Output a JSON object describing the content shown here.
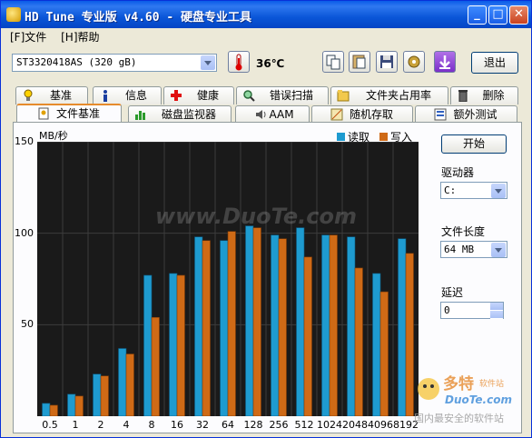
{
  "window": {
    "title": "HD Tune 专业版 v4.60 - 硬盘专业工具"
  },
  "menu": {
    "file": "[F]文件",
    "help": "[H]帮助"
  },
  "toolbar": {
    "drive": "ST3320418AS (320 gB)",
    "temperature": "36℃",
    "exit_label": "退出"
  },
  "tabs_top": [
    "基准",
    "信息",
    "健康",
    "错误扫描",
    "文件夹占用率",
    "删除"
  ],
  "tabs_bottom": [
    "文件基准",
    "磁盘监视器",
    "AAM",
    "随机存取",
    "额外测试"
  ],
  "active_tab": "文件基准",
  "right_panel": {
    "start_label": "开始",
    "drive_label": "驱动器",
    "drive_value": "C:",
    "length_label": "文件长度",
    "length_value": "64 MB",
    "delay_label": "延迟",
    "delay_value": "0"
  },
  "watermark": "www.DuoTe.com",
  "brand": {
    "name": "多特",
    "sub": "软件站",
    "url": "DuoTe.com",
    "slogan": "国内最安全的软件站"
  },
  "colors": {
    "read": "#1e9bd0",
    "write": "#cf6a16",
    "plot_bg": "#1a1a1a"
  },
  "chart_data": {
    "type": "bar",
    "ylabel": "MB/秒",
    "ylim": [
      0,
      150
    ],
    "yticks": [
      50,
      100,
      150
    ],
    "categories": [
      "0.5",
      "1",
      "2",
      "4",
      "8",
      "16",
      "32",
      "64",
      "128",
      "256",
      "512",
      "1024",
      "2048",
      "4096",
      "8192"
    ],
    "series": [
      {
        "name": "读取",
        "values": [
          7,
          12,
          23,
          37,
          77,
          78,
          98,
          96,
          104,
          99,
          103,
          99,
          98,
          78,
          97
        ]
      },
      {
        "name": "写入",
        "values": [
          6,
          11,
          22,
          34,
          54,
          77,
          96,
          101,
          103,
          97,
          87,
          99,
          81,
          68,
          89
        ]
      }
    ]
  }
}
